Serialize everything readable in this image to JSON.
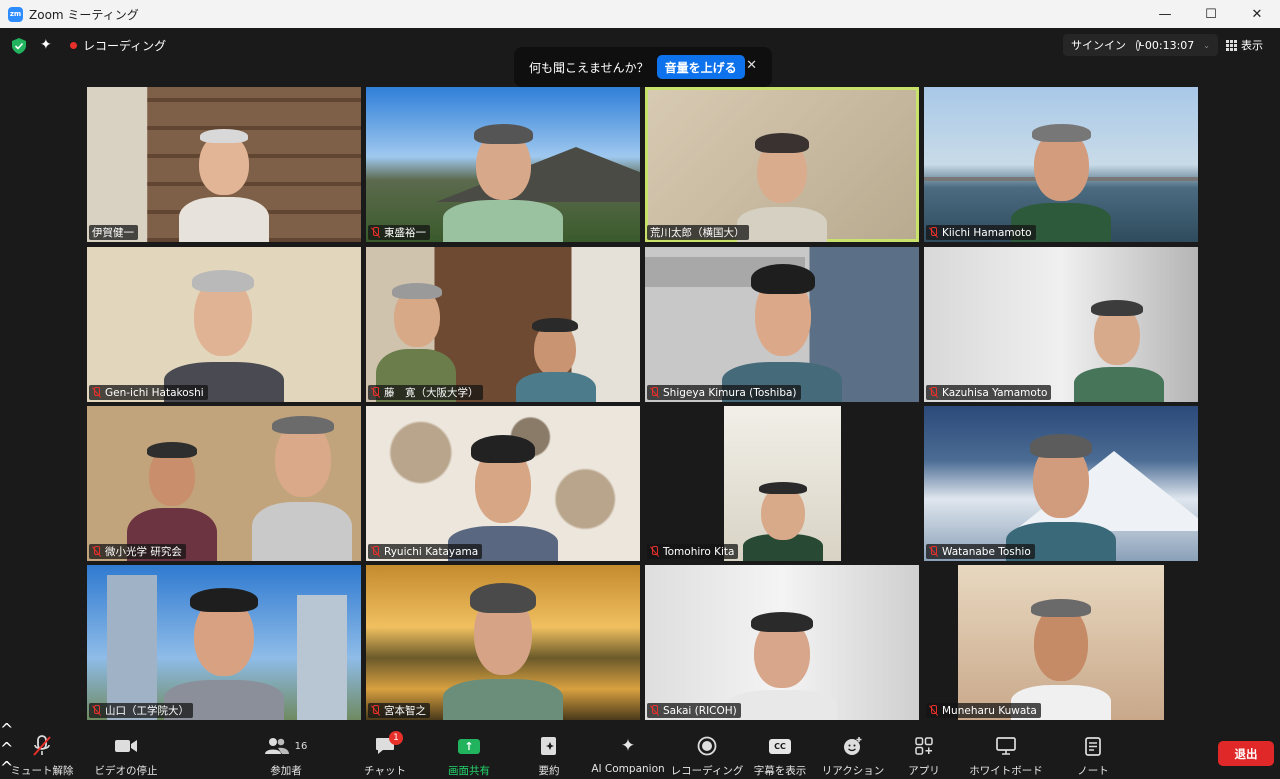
{
  "window": {
    "title": "Zoom ミーティング",
    "logo_text": "zm",
    "controls": [
      "—",
      "☐",
      "✕"
    ]
  },
  "topbar": {
    "recording_label": "レコーディング",
    "signin_label": "サインイン",
    "timer": "00:13:07",
    "view_label": "表示"
  },
  "toast": {
    "message": "何も聞こえませんか？",
    "action_label": "音量を上げる",
    "close": "✕"
  },
  "participants": [
    {
      "name": "伊賀健一"
    },
    {
      "name": "東盛裕一"
    },
    {
      "name": "荒川太郎（横国大）"
    },
    {
      "name": "Kiichi Hamamoto"
    },
    {
      "name": "Gen-ichi Hatakoshi"
    },
    {
      "name": "藤　寛（大阪大学）"
    },
    {
      "name": "Shigeya Kimura (Toshiba)"
    },
    {
      "name": "Kazuhisa Yamamoto"
    },
    {
      "name": "微小光学 研究会"
    },
    {
      "name": "Ryuichi Katayama"
    },
    {
      "name": "Tomohiro Kita"
    },
    {
      "name": "Watanabe Toshio"
    },
    {
      "name": "山口（工学院大）"
    },
    {
      "name": "宮本智之"
    },
    {
      "name": "Sakai (RICOH)"
    },
    {
      "name": "Muneharu Kuwata"
    }
  ],
  "toolbar": {
    "mute_label": "ミュート解除",
    "video_label": "ビデオの停止",
    "participants_label": "参加者",
    "participants_count": "16",
    "chat_label": "チャット",
    "chat_badge": "1",
    "share_label": "画面共有",
    "summary_label": "要約",
    "ai_label": "AI Companion",
    "record_label": "レコーディング",
    "captions_label": "字幕を表示",
    "cc_text": "CC",
    "reactions_label": "リアクション",
    "apps_label": "アプリ",
    "whiteboard_label": "ホワイトボード",
    "notes_label": "ノート",
    "leave_label": "退出"
  },
  "colors": {
    "accent": "#0e72ed",
    "share_green": "#22b35e",
    "leave_red": "#e02828",
    "active_speaker": "#c8e26b",
    "muted_red": "#e8302b"
  }
}
